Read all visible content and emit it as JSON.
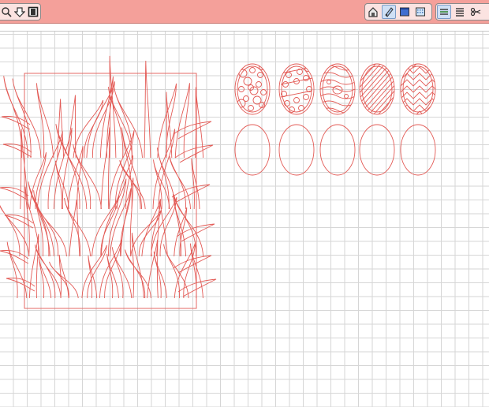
{
  "toolbar": {
    "left_tools": [
      "zoom-tool-icon",
      "move-down-icon",
      "page-icon"
    ],
    "group1": [
      "home-icon",
      "pen-icon",
      "fill-icon",
      "pattern-icon"
    ],
    "group2": [
      "lines-icon",
      "align-icon",
      "scissors-icon"
    ]
  },
  "canvas": {
    "cut_line_color": "#e35a55",
    "grid_color": "#d6d6d6",
    "objects": [
      {
        "type": "grass-block"
      },
      {
        "type": "egg",
        "pattern": "dots"
      },
      {
        "type": "egg",
        "pattern": "circles"
      },
      {
        "type": "egg",
        "pattern": "waves"
      },
      {
        "type": "egg",
        "pattern": "diagonal-stripes"
      },
      {
        "type": "egg",
        "pattern": "chevrons"
      },
      {
        "type": "egg-outline"
      },
      {
        "type": "egg-outline"
      },
      {
        "type": "egg-outline"
      },
      {
        "type": "egg-outline"
      },
      {
        "type": "egg-outline"
      }
    ]
  }
}
